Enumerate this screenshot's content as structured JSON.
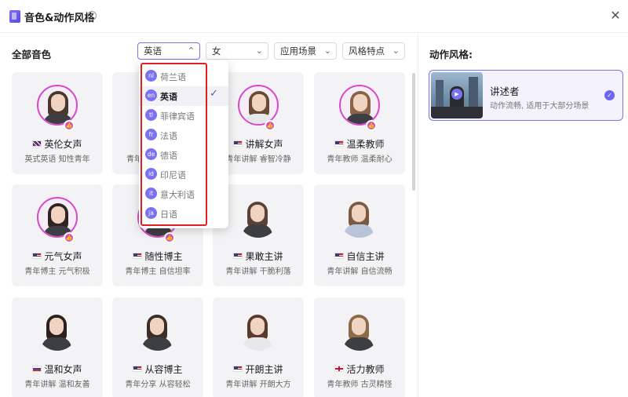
{
  "window": {
    "title": "音色&动作风格"
  },
  "voices": {
    "section_title": "全部音色",
    "filters": [
      {
        "value": "英语"
      },
      {
        "value": "女"
      },
      {
        "value": "应用场景"
      },
      {
        "value": "风格特点"
      }
    ],
    "cards": [
      {
        "name": "英伦女声",
        "desc": "英式英语 知性青年",
        "flag": "uk"
      },
      {
        "name": "",
        "desc": "青年",
        "flag": ""
      },
      {
        "name": "讲解女声",
        "desc": "青年讲解 睿智冷静",
        "flag": "us"
      },
      {
        "name": "温柔教师",
        "desc": "青年教师 温柔耐心",
        "flag": "us"
      },
      {
        "name": "元气女声",
        "desc": "青年博主 元气积极",
        "flag": "us"
      },
      {
        "name": "随性博主",
        "desc": "青年博主 自信坦率",
        "flag": "us"
      },
      {
        "name": "果敢主讲",
        "desc": "青年讲解 干脆利落",
        "flag": "us"
      },
      {
        "name": "自信主讲",
        "desc": "青年讲解 自信流畅",
        "flag": "us"
      },
      {
        "name": "温和女声",
        "desc": "青年讲解 温和友善",
        "flag": "ru"
      },
      {
        "name": "从容博主",
        "desc": "青年分享 从容轻松",
        "flag": "us"
      },
      {
        "name": "开朗主讲",
        "desc": "青年讲解 开朗大方",
        "flag": "us"
      },
      {
        "name": "活力教师",
        "desc": "青年教师 古灵精怪",
        "flag": "en"
      }
    ]
  },
  "language_dropdown": {
    "items": [
      {
        "code": "nl",
        "label": "荷兰语"
      },
      {
        "code": "en",
        "label": "英语",
        "selected": true
      },
      {
        "code": "tl",
        "label": "菲律宾语"
      },
      {
        "code": "fr",
        "label": "法语"
      },
      {
        "code": "de",
        "label": "德语"
      },
      {
        "code": "id",
        "label": "印尼语"
      },
      {
        "code": "it",
        "label": "意大利语"
      },
      {
        "code": "ja",
        "label": "日语"
      }
    ]
  },
  "action_style": {
    "section_title": "动作风格:",
    "selected": {
      "name": "讲述者",
      "desc": "动作流畅, 适用于大部分场景"
    }
  },
  "colors": {
    "accent": "#7b73f0",
    "highlight_box": "#e02020",
    "badge": "#d749c8"
  },
  "icons": {
    "info": "info-icon",
    "close": "close-icon",
    "chevron": "chevron-down-icon",
    "check": "check-icon",
    "like": "thumbs-up-icon",
    "play": "play-icon"
  }
}
